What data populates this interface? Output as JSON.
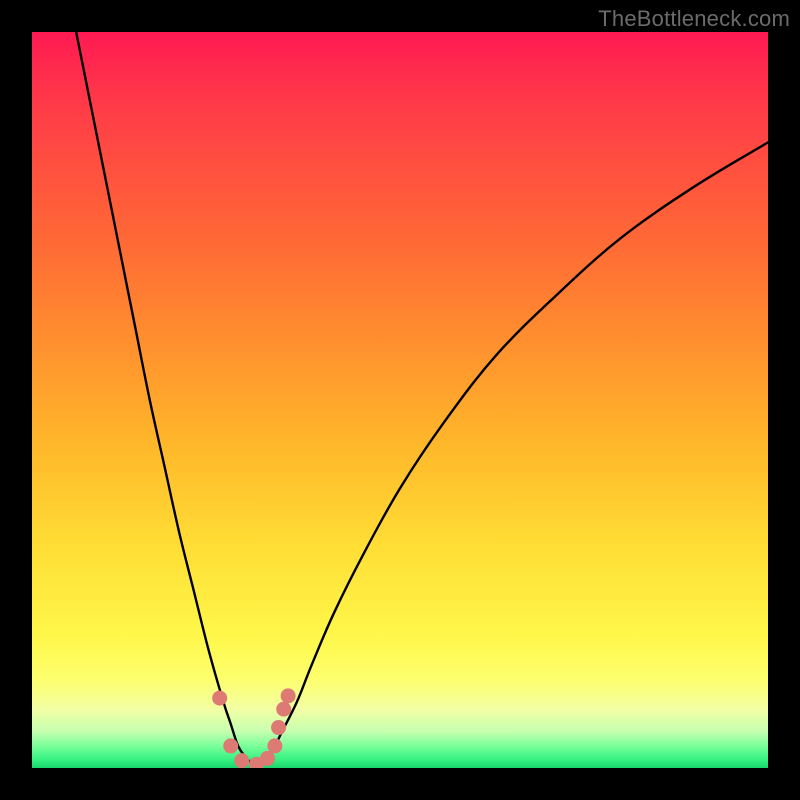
{
  "watermark": {
    "text": "TheBottleneck.com"
  },
  "colors": {
    "page_bg": "#000000",
    "curve": "#000000",
    "marker_fill": "#dd7a74",
    "marker_stroke": "#b94e46",
    "gradient_stops": [
      "#ff1a52",
      "#ff3b48",
      "#ff6836",
      "#ff8f2e",
      "#ffb72a",
      "#ffde35",
      "#fff74a",
      "#fdff6e",
      "#f3ffa4",
      "#c6ffb0",
      "#7bff9a",
      "#30f07e",
      "#19d46c"
    ]
  },
  "chart_data": {
    "type": "line",
    "title": "",
    "xlabel": "",
    "ylabel": "",
    "xlim": [
      0,
      100
    ],
    "ylim": [
      0,
      100
    ],
    "note": "Axes are implied (no ticks shown). x ≈ relative hardware balance, y ≈ bottleneck %. Values estimated from pixel positions.",
    "series": [
      {
        "name": "left-branch",
        "x": [
          6,
          8,
          10,
          12,
          14,
          16,
          18,
          20,
          22,
          24,
          26,
          27,
          28,
          29,
          30
        ],
        "y": [
          100,
          90,
          80,
          70,
          60,
          50,
          41,
          32,
          24,
          16,
          9,
          6,
          3,
          1.5,
          0.5
        ]
      },
      {
        "name": "right-branch",
        "x": [
          31,
          32,
          33,
          34,
          36,
          38,
          41,
          45,
          50,
          56,
          63,
          71,
          80,
          90,
          100
        ],
        "y": [
          0.5,
          1.5,
          3,
          5,
          9,
          14,
          21,
          29,
          38,
          47,
          56,
          64,
          72,
          79,
          85
        ]
      }
    ],
    "markers": [
      {
        "x": 25.5,
        "y": 9.5
      },
      {
        "x": 27.0,
        "y": 3.0
      },
      {
        "x": 28.5,
        "y": 1.0
      },
      {
        "x": 30.5,
        "y": 0.5
      },
      {
        "x": 32.0,
        "y": 1.3
      },
      {
        "x": 33.0,
        "y": 3.0
      },
      {
        "x": 33.5,
        "y": 5.5
      },
      {
        "x": 34.2,
        "y": 8.0
      },
      {
        "x": 34.8,
        "y": 9.8
      }
    ]
  }
}
